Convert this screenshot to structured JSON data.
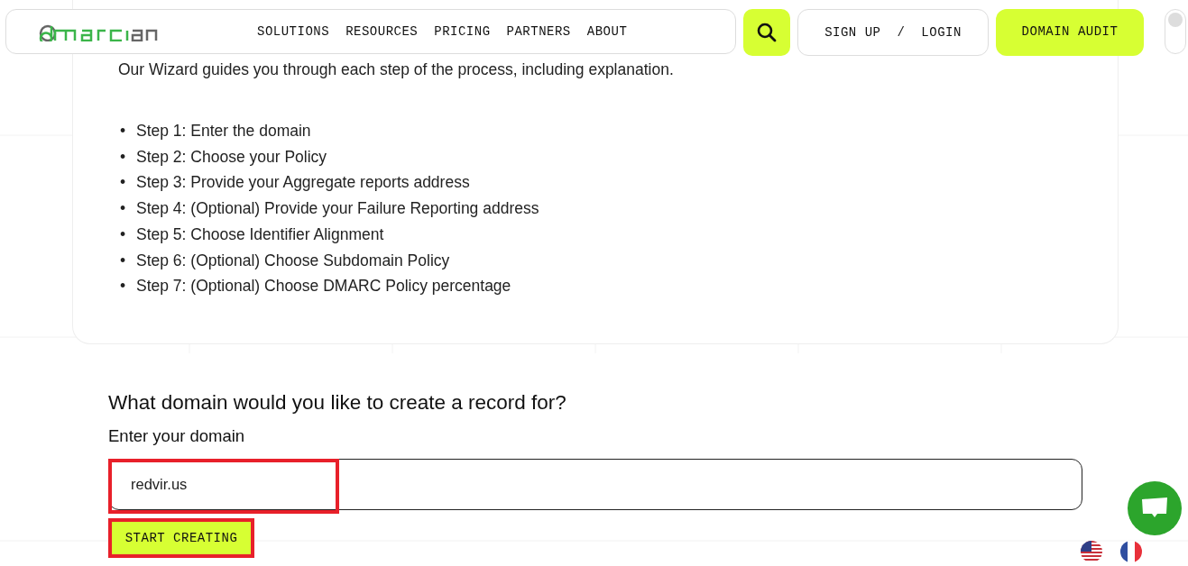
{
  "header": {
    "nav": [
      "SOLUTIONS",
      "RESOURCES",
      "PRICING",
      "PARTNERS",
      "ABOUT"
    ],
    "sign_up": "SIGN UP",
    "separator": "/",
    "login": "LOGIN",
    "audit": "DOMAIN AUDIT",
    "dark_mode": false
  },
  "wizard": {
    "intro": "Our Wizard guides you through each step of the process, including explanation.",
    "steps": [
      {
        "marker": "•",
        "text": "Step 1: Enter the domain"
      },
      {
        "marker": "•",
        "text": "Step 2: Choose your Policy"
      },
      {
        "marker": "•",
        "text": "Step 3: Provide your Aggregate reports address"
      },
      {
        "marker": "•",
        "text": "Step 4: (Optional) Provide your Failure Reporting address"
      },
      {
        "marker": "•",
        "text": "Step 5: Choose Identifier Alignment"
      },
      {
        "marker": "•",
        "text": "Step 6: (Optional) Choose Subdomain Policy"
      },
      {
        "marker": "•",
        "text": "Step 7: (Optional) Choose DMARC Policy percentage"
      }
    ]
  },
  "form": {
    "question": "What domain would you like to create a record for?",
    "label": "Enter your domain",
    "value": "redvir.us",
    "value_highlighted": true,
    "button": "START CREATING",
    "button_highlighted": true
  },
  "languages": [
    {
      "kind": "us"
    },
    {
      "kind": "fr"
    }
  ]
}
